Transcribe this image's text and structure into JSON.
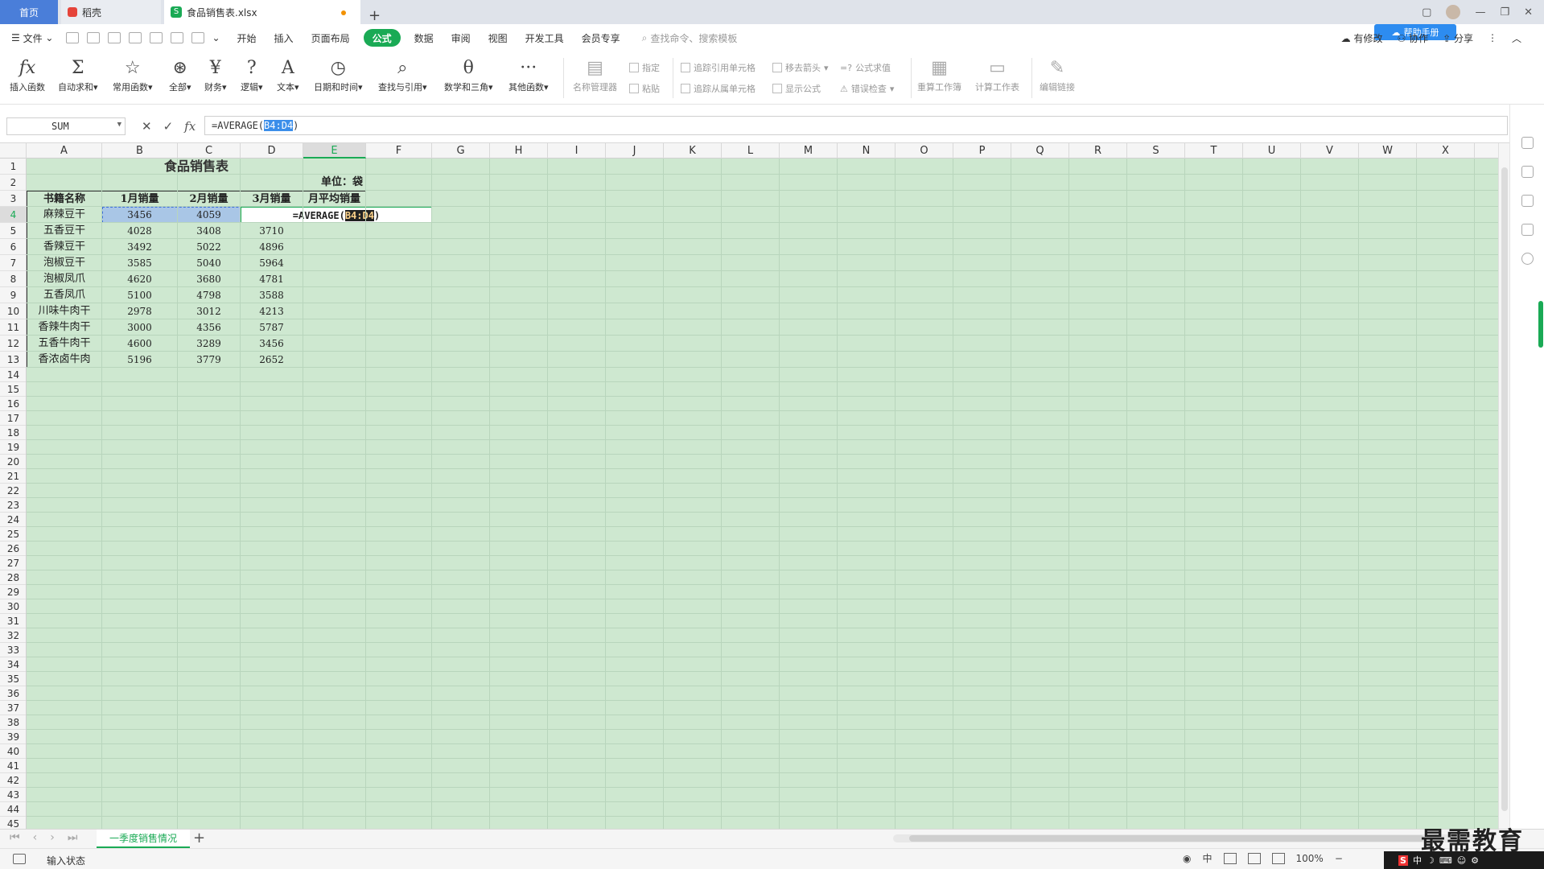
{
  "tabs": {
    "home": "首页",
    "daoke": "稻壳",
    "file": "食品销售表.xlsx",
    "add": "+"
  },
  "window": {
    "minimize": "—",
    "restore": "❐",
    "close": "✕",
    "pill": "帮助手册"
  },
  "menu": {
    "file": "文件",
    "items": [
      "开始",
      "插入",
      "页面布局",
      "公式",
      "数据",
      "审阅",
      "视图",
      "开发工具",
      "会员专享"
    ],
    "active_index": 3,
    "search_placeholder": "查找命令、搜索模板",
    "right": {
      "changes": "有修改",
      "collab": "协作",
      "share": "分享"
    }
  },
  "ribbon": {
    "insert_fn": "插入函数",
    "autosum": "自动求和",
    "common": "常用函数",
    "all": "全部",
    "finance": "财务",
    "logic": "逻辑",
    "text": "文本",
    "datetime": "日期和时间",
    "lookup": "查找与引用",
    "math": "数学和三角",
    "other": "其他函数",
    "name_mgr": "名称管理器",
    "assign": "指定",
    "paste": "粘贴",
    "trace_prec": "追踪引用单元格",
    "trace_dep": "追踪从属单元格",
    "remove_arrows": "移去箭头",
    "show_formula": "显示公式",
    "eval": "公式求值",
    "error_check": "错误检查",
    "recalc_book": "重算工作簿",
    "calc_sheet": "计算工作表",
    "edit_links": "编辑链接"
  },
  "formula_bar": {
    "name_box": "SUM",
    "formula_prefix": "=AVERAGE(",
    "formula_ref": "B4:D4",
    "formula_suffix": ")"
  },
  "columns": [
    "A",
    "B",
    "C",
    "D",
    "E",
    "F",
    "G",
    "H",
    "I",
    "J",
    "K",
    "L",
    "M",
    "N",
    "O",
    "P",
    "Q",
    "R",
    "S",
    "T",
    "U",
    "V",
    "W",
    "X"
  ],
  "rows": [
    "1",
    "2",
    "3",
    "4",
    "5",
    "6",
    "7",
    "8",
    "9",
    "10",
    "11",
    "12",
    "13",
    "14",
    "15",
    "16",
    "17",
    "18",
    "19",
    "20",
    "21",
    "22",
    "23",
    "24",
    "25",
    "26",
    "27",
    "28",
    "29",
    "30",
    "31",
    "32",
    "33",
    "34",
    "35",
    "36",
    "37",
    "38",
    "39",
    "40",
    "41",
    "42",
    "43",
    "44",
    "45"
  ],
  "sheet": {
    "title": "食品销售表",
    "unit": "单位：袋",
    "headers": [
      "书籍名称",
      "1月销量",
      "2月销量",
      "3月销量",
      "月平均销量"
    ],
    "data": [
      [
        "麻辣豆干",
        "3456",
        "4059",
        ""
      ],
      [
        "五香豆干",
        "4028",
        "3408",
        "3710"
      ],
      [
        "香辣豆干",
        "3492",
        "5022",
        "4896"
      ],
      [
        "泡椒豆干",
        "3585",
        "5040",
        "5964"
      ],
      [
        "泡椒凤爪",
        "4620",
        "3680",
        "4781"
      ],
      [
        "五香凤爪",
        "5100",
        "4798",
        "3588"
      ],
      [
        "川味牛肉干",
        "2978",
        "3012",
        "4213"
      ],
      [
        "香辣牛肉干",
        "3000",
        "4356",
        "5787"
      ],
      [
        "五香牛肉干",
        "4600",
        "3289",
        "3456"
      ],
      [
        "香浓卤牛肉",
        "5196",
        "3779",
        "2652"
      ]
    ],
    "editing_prefix": "=AVERAGE(",
    "editing_ref": "B4:D4",
    "editing_suffix": ")"
  },
  "sheet_tab": "一季度销售情况",
  "status": {
    "mode": "输入状态",
    "lang": "中",
    "zoom": "100%"
  },
  "watermark": "最需教育",
  "tray": {
    "ime": "中"
  }
}
